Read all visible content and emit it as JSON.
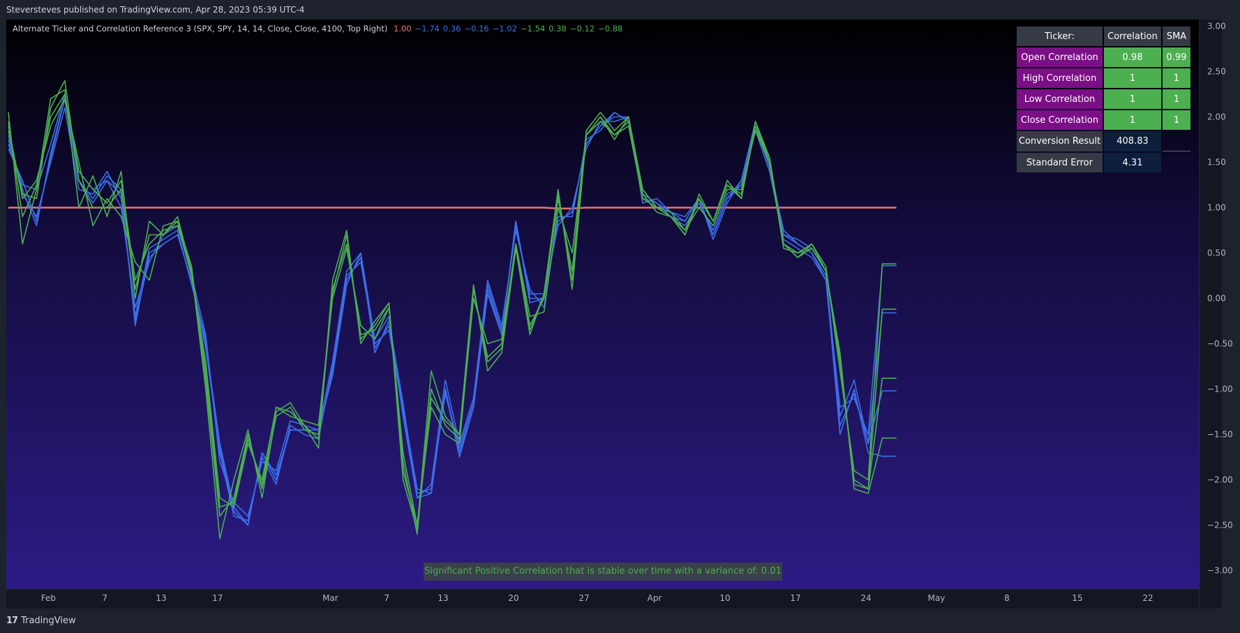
{
  "header": {
    "attribution": "Steversteves published on TradingView.com, Apr 28, 2023 05:39 UTC-4"
  },
  "footer": {
    "logo_text": "TradingView",
    "logo_mark": "17"
  },
  "indicator": {
    "title": "Alternate Ticker and Correlation Reference 3 (SPX, SPY, 14, 14, Close, Close, 4100, Top Right)",
    "values": [
      {
        "text": "1.00",
        "color": "#f07070"
      },
      {
        "text": "−1.74",
        "color": "#3d6ee8"
      },
      {
        "text": "0.36",
        "color": "#3d6ee8"
      },
      {
        "text": "−0.16",
        "color": "#3d6ee8"
      },
      {
        "text": "−1.02",
        "color": "#3d6ee8"
      },
      {
        "text": "−1.54",
        "color": "#4caf50"
      },
      {
        "text": "0.38",
        "color": "#4caf50"
      },
      {
        "text": "−0.12",
        "color": "#4caf50"
      },
      {
        "text": "−0.88",
        "color": "#4caf50"
      }
    ]
  },
  "status_message": "Significant Positive Correlation that is stable over time with a variance of: 0.01",
  "table": {
    "headers": [
      "Ticker:",
      "Correlation",
      "SMA"
    ],
    "rows": [
      {
        "label": "Open Correlation",
        "corr": "0.98",
        "sma": "0.99"
      },
      {
        "label": "High Correlation",
        "corr": "1",
        "sma": "1"
      },
      {
        "label": "Low Correlation",
        "corr": "1",
        "sma": "1"
      },
      {
        "label": "Close Correlation",
        "corr": "1",
        "sma": "1"
      },
      {
        "label": "Conversion Result",
        "corr": "408.83",
        "sma": ""
      },
      {
        "label": "Standard Error",
        "corr": "4.31",
        "sma": ""
      }
    ]
  },
  "colors": {
    "correlation_line": "#f07070",
    "blue_series": "#3d6ee8",
    "green_series": "#4caf50",
    "bg_top": "#000000",
    "bg_bottom": "#2c1b85"
  },
  "chart_data": {
    "type": "line",
    "ylim": [
      -3.2,
      3.05
    ],
    "y_ticks": [
      "3.00",
      "2.50",
      "2.00",
      "1.50",
      "1.00",
      "0.50",
      "0.00",
      "−0.50",
      "−1.00",
      "−1.50",
      "−2.00",
      "−2.50",
      "−3.00"
    ],
    "y_tick_values": [
      3,
      2.5,
      2,
      1.5,
      1,
      0.5,
      0,
      -0.5,
      -1,
      -1.5,
      -2,
      -2.5,
      -3
    ],
    "x_ticks": [
      {
        "label": "Feb",
        "i": 2
      },
      {
        "label": "7",
        "i": 6
      },
      {
        "label": "13",
        "i": 10
      },
      {
        "label": "17",
        "i": 14
      },
      {
        "label": "Mar",
        "i": 22
      },
      {
        "label": "7",
        "i": 26
      },
      {
        "label": "13",
        "i": 30
      },
      {
        "label": "20",
        "i": 35
      },
      {
        "label": "27",
        "i": 40
      },
      {
        "label": "Apr",
        "i": 45
      },
      {
        "label": "10",
        "i": 50
      },
      {
        "label": "17",
        "i": 55
      },
      {
        "label": "24",
        "i": 60
      },
      {
        "label": "May",
        "i": 65
      },
      {
        "label": "8",
        "i": 70
      },
      {
        "label": "15",
        "i": 75
      },
      {
        "label": "22",
        "i": 80
      }
    ],
    "n_points": 64,
    "series": [
      {
        "color": "#f07070",
        "values": [
          1,
          1,
          1,
          1,
          1,
          1,
          1,
          1,
          1,
          1,
          1,
          1,
          1,
          1,
          1,
          1,
          1,
          1,
          1,
          1,
          1,
          1,
          1,
          1,
          1,
          1,
          1,
          1,
          1,
          1,
          1,
          1,
          1,
          1,
          1,
          1,
          1,
          1,
          1,
          0.99,
          0.99,
          1,
          1,
          1,
          1,
          1,
          1,
          1,
          1,
          1,
          1,
          1,
          1,
          1,
          1,
          1,
          1,
          1,
          1,
          1,
          1,
          1,
          1,
          1
        ]
      },
      {
        "color": "#3d6ee8",
        "values": [
          1.75,
          1.2,
          0.8,
          1.6,
          2.2,
          1.3,
          1.1,
          1.35,
          1.2,
          -0.3,
          0.5,
          0.6,
          0.7,
          0.2,
          -0.5,
          -1.6,
          -2.3,
          -2.5,
          -1.7,
          -2.0,
          -1.45,
          -1.45,
          -1.5,
          -0.8,
          0.2,
          0.45,
          -0.55,
          -0.3,
          -1.2,
          -2.1,
          -2.15,
          -1.0,
          -1.7,
          -1.2,
          0.1,
          -0.4,
          0.85,
          0.0,
          0.0,
          0.85,
          0.95,
          1.7,
          1.9,
          2.0,
          2.0,
          1.1,
          1.05,
          0.95,
          0.85,
          1.1,
          0.7,
          1.1,
          1.3,
          1.9,
          1.45,
          0.7,
          0.6,
          0.5,
          0.25,
          -1.5,
          -1.0,
          -1.7,
          -1.74,
          -1.74
        ]
      },
      {
        "color": "#3d6ee8",
        "values": [
          1.7,
          1.25,
          1.2,
          1.7,
          2.25,
          1.4,
          1.2,
          1.3,
          1.0,
          -0.1,
          0.4,
          0.7,
          0.8,
          0.25,
          -0.4,
          -1.8,
          -2.25,
          -2.4,
          -1.8,
          -1.9,
          -1.35,
          -1.4,
          -1.45,
          -0.7,
          0.3,
          0.5,
          -0.45,
          -0.2,
          -1.3,
          -2.2,
          -2.05,
          -0.9,
          -1.6,
          -1.1,
          0.2,
          -0.3,
          0.75,
          0.1,
          -0.1,
          0.9,
          0.9,
          1.75,
          1.85,
          2.05,
          1.95,
          1.15,
          1.05,
          0.9,
          0.8,
          1.05,
          0.75,
          1.15,
          1.25,
          1.85,
          1.4,
          0.65,
          0.55,
          0.45,
          0.2,
          -1.2,
          -1.1,
          -1.5,
          0.36,
          0.36
        ]
      },
      {
        "color": "#3d6ee8",
        "values": [
          1.8,
          1.15,
          0.9,
          1.5,
          2.1,
          1.2,
          1.15,
          1.4,
          1.1,
          -0.2,
          0.55,
          0.65,
          0.75,
          0.15,
          -0.45,
          -1.7,
          -2.4,
          -2.45,
          -1.75,
          -2.05,
          -1.4,
          -1.5,
          -1.55,
          -0.75,
          0.25,
          0.4,
          -0.5,
          -0.35,
          -1.25,
          -2.15,
          -2.1,
          -1.05,
          -1.65,
          -1.15,
          0.15,
          -0.35,
          0.8,
          0.05,
          0.05,
          0.8,
          1.0,
          1.65,
          1.95,
          1.95,
          2.0,
          1.05,
          1.1,
          0.95,
          0.9,
          1.1,
          0.65,
          1.05,
          1.3,
          1.95,
          1.5,
          0.7,
          0.65,
          0.55,
          0.3,
          -1.3,
          -0.9,
          -1.6,
          -0.16,
          -0.16
        ]
      },
      {
        "color": "#3d6ee8",
        "values": [
          1.65,
          1.3,
          0.85,
          1.55,
          2.2,
          1.3,
          1.05,
          1.3,
          1.15,
          -0.25,
          0.45,
          0.6,
          0.7,
          0.2,
          -0.55,
          -1.65,
          -2.35,
          -2.5,
          -1.7,
          -1.95,
          -1.45,
          -1.45,
          -1.45,
          -0.85,
          0.15,
          0.5,
          -0.6,
          -0.25,
          -1.15,
          -2.2,
          -2.15,
          -1.0,
          -1.75,
          -1.2,
          0.05,
          -0.4,
          0.85,
          -0.05,
          0.0,
          0.85,
          0.95,
          1.7,
          1.9,
          2.05,
          1.95,
          1.1,
          1.0,
          0.9,
          0.85,
          1.1,
          0.7,
          1.1,
          1.25,
          1.9,
          1.45,
          0.75,
          0.6,
          0.5,
          0.2,
          -1.4,
          -1.05,
          -1.6,
          -1.02,
          -1.02
        ]
      },
      {
        "color": "#4caf50",
        "values": [
          2.05,
          0.6,
          1.2,
          2.2,
          2.3,
          1.0,
          1.35,
          0.9,
          1.4,
          0.0,
          0.85,
          0.7,
          0.9,
          0.3,
          -1.0,
          -2.65,
          -2.0,
          -1.45,
          -2.2,
          -1.25,
          -1.15,
          -1.4,
          -1.65,
          0.2,
          0.75,
          -0.5,
          -0.25,
          -0.05,
          -2.0,
          -2.55,
          -0.8,
          -1.3,
          -1.5,
          0.15,
          -0.8,
          -0.6,
          0.55,
          -0.4,
          0.05,
          1.2,
          0.1,
          1.8,
          2.0,
          1.75,
          2.0,
          1.2,
          1.0,
          0.9,
          0.7,
          1.15,
          0.85,
          1.3,
          1.1,
          1.95,
          1.55,
          0.6,
          0.45,
          0.55,
          0.3,
          -0.6,
          -2.1,
          -2.15,
          -1.54,
          -1.54
        ]
      },
      {
        "color": "#4caf50",
        "values": [
          1.9,
          1.1,
          1.3,
          1.9,
          2.2,
          1.5,
          0.8,
          1.1,
          0.9,
          0.4,
          0.2,
          0.8,
          0.85,
          0.25,
          -0.7,
          -2.2,
          -2.3,
          -1.6,
          -2.0,
          -1.2,
          -1.3,
          -1.35,
          -1.4,
          0.0,
          0.55,
          -0.3,
          -0.45,
          -0.1,
          -1.7,
          -2.5,
          -1.2,
          -1.5,
          -1.6,
          0.0,
          -0.5,
          -0.45,
          0.6,
          -0.2,
          -0.15,
          1.0,
          0.5,
          1.8,
          1.95,
          1.8,
          1.9,
          1.1,
          1.0,
          0.95,
          0.75,
          1.0,
          0.8,
          1.2,
          1.2,
          1.85,
          1.5,
          0.55,
          0.5,
          0.6,
          0.35,
          -0.8,
          -1.9,
          -2.0,
          0.38,
          0.38
        ]
      },
      {
        "color": "#4caf50",
        "values": [
          1.85,
          1.15,
          1.1,
          2.1,
          2.4,
          1.3,
          1.0,
          1.0,
          1.2,
          0.1,
          0.7,
          0.7,
          0.85,
          0.35,
          -0.9,
          -2.4,
          -2.2,
          -1.5,
          -2.1,
          -1.3,
          -1.2,
          -1.45,
          -1.5,
          0.1,
          0.6,
          -0.4,
          -0.35,
          -0.1,
          -1.8,
          -2.6,
          -1.0,
          -1.4,
          -1.55,
          0.1,
          -0.65,
          -0.5,
          0.6,
          -0.3,
          0.0,
          1.1,
          0.3,
          1.85,
          2.05,
          1.85,
          2.0,
          1.15,
          0.95,
          0.9,
          0.7,
          1.1,
          0.85,
          1.25,
          1.15,
          1.9,
          1.55,
          0.6,
          0.5,
          0.55,
          0.3,
          -0.7,
          -2.0,
          -2.1,
          -0.12,
          -0.12
        ]
      },
      {
        "color": "#4caf50",
        "values": [
          1.95,
          0.9,
          1.25,
          2.0,
          2.25,
          1.4,
          1.2,
          1.05,
          1.3,
          0.2,
          0.6,
          0.75,
          0.8,
          0.3,
          -0.8,
          -2.3,
          -2.25,
          -1.55,
          -2.05,
          -1.2,
          -1.25,
          -1.4,
          -1.55,
          0.05,
          0.7,
          -0.45,
          -0.3,
          -0.05,
          -1.9,
          -2.5,
          -1.1,
          -1.35,
          -1.5,
          0.1,
          -0.7,
          -0.55,
          0.55,
          -0.35,
          0.05,
          1.15,
          0.2,
          1.8,
          2.0,
          1.8,
          1.95,
          1.2,
          1.0,
          0.9,
          0.75,
          1.1,
          0.85,
          1.25,
          1.1,
          1.9,
          1.5,
          0.6,
          0.45,
          0.6,
          0.3,
          -0.65,
          -2.05,
          -2.1,
          -0.88,
          -0.88
        ]
      }
    ]
  }
}
